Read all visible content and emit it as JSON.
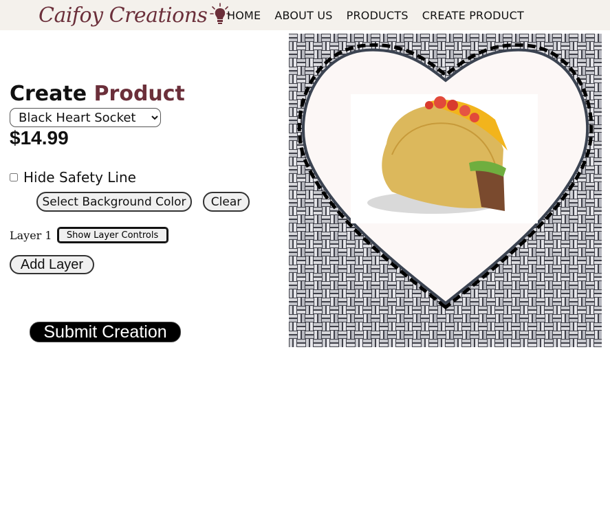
{
  "header": {
    "logo_text": "Caifoy Creations",
    "logo_icon": "lightbulb-icon",
    "nav": [
      "HOME",
      "ABOUT US",
      "PRODUCTS",
      "CREATE PRODUCT"
    ],
    "background": "#f4f1ec",
    "brand_color": "#6b2f3a"
  },
  "builder": {
    "title_main": "Create",
    "title_accent": "Product",
    "product_select": {
      "selected": "Black Heart Socket"
    },
    "price": "$14.99",
    "hide_safety_line": {
      "label": "Hide Safety Line",
      "checked": false
    },
    "select_bg_label": "Select Background Color",
    "clear_label": "Clear",
    "layers": [
      {
        "label": "Layer 1",
        "controls_button": "Show Layer Controls"
      }
    ],
    "add_layer_label": "Add Layer",
    "submit_label": "Submit Creation"
  },
  "preview": {
    "background_pattern": "woven-basket-texture",
    "shape": "heart",
    "safety_line": "dashed",
    "layer_image": "taco"
  }
}
